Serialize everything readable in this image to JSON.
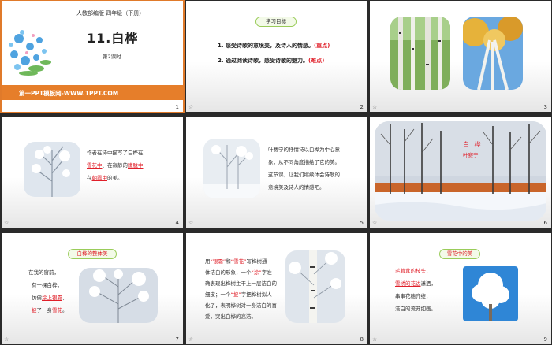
{
  "slides": [
    {
      "num": "1",
      "grade": "人教部编版·四年级（下册）",
      "title": "11.白桦",
      "period": "第2课时",
      "footer": "第一PPT模板网-WWW.1PPT.COM"
    },
    {
      "num": "2",
      "tag": "学习目标",
      "goal1": "1. 感受诗歌的意境美，及诗人的情感。",
      "goal1_key": "(重点)",
      "goal2": "2. 通过阅读诗歌，感受诗歌的魅力。",
      "goal2_key": "(难点)"
    },
    {
      "num": "3"
    },
    {
      "num": "4",
      "t1": "作者在诗中描写了白桦在",
      "t2a": "雪花中",
      "t2b": "、在寂静的",
      "t2c": "朦胧中",
      "t3a": "在",
      "t3b": "朝霞中",
      "t3c": "的美。"
    },
    {
      "num": "5",
      "t1": "叶赛宁的抒情诗以白桦为中心意",
      "t2": "象，从不同角度描绘了它的美。",
      "t3": "这节课，让我们继续体会诗歌的",
      "t4": "意境美及诗人的情感吧。"
    },
    {
      "num": "6",
      "title1": "白 桦",
      "title2": "叶赛宁"
    },
    {
      "num": "7",
      "tag": "白桦的整体美",
      "l1": "在我的窗前，",
      "l2": "有一棵白桦，",
      "l3a": "仿佛",
      "l3b": "涂上银霜",
      "l3c": "，",
      "l4a": "披",
      "l4b": "了一身",
      "l4c": "雪花",
      "l4d": "。"
    },
    {
      "num": "8",
      "l1a": "用",
      "l1b": "“银霜”",
      "l1c": "和",
      "l1d": "“雪花”",
      "l1e": "写桦树通",
      "l2": "体洁白的形象，一个",
      "l2b": "“涂”",
      "l2c": "字准",
      "l3": "确表现出桦树主干上一层洁白的",
      "l4a": "细皮；一个",
      "l4b": "“披”",
      "l4c": "字把桦树拟人",
      "l5": "化了，表明桦树对一身洁白的喜",
      "l6": "爱，突出白桦的高洁。"
    },
    {
      "num": "9",
      "tag": "雪花中的美",
      "l1": "毛茸茸的枝头，",
      "l2a": "雪绣的花边",
      "l2b": "潇洒，",
      "l3": "串串花穗齐绽，",
      "l4": "洁白的流苏如画。"
    }
  ],
  "star": "☆"
}
